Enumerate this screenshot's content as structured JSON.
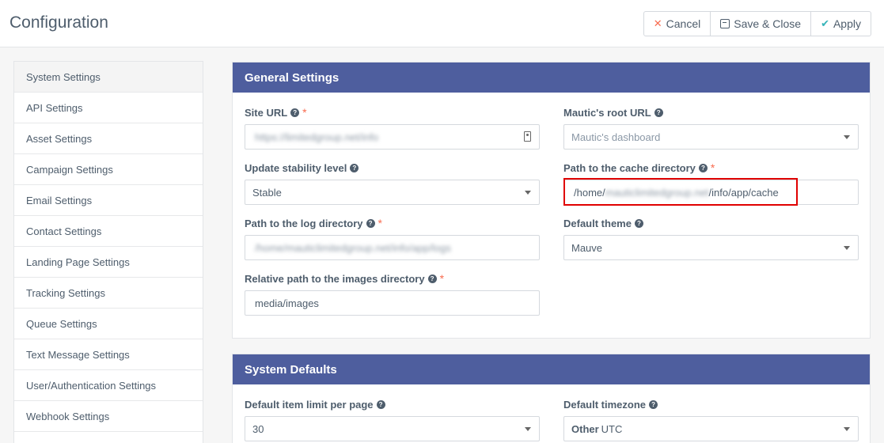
{
  "page": {
    "title": "Configuration"
  },
  "toolbar": {
    "cancel_label": "Cancel",
    "save_close_label": "Save & Close",
    "apply_label": "Apply"
  },
  "sidebar": {
    "items": [
      {
        "label": "System Settings"
      },
      {
        "label": "API Settings"
      },
      {
        "label": "Asset Settings"
      },
      {
        "label": "Campaign Settings"
      },
      {
        "label": "Email Settings"
      },
      {
        "label": "Contact Settings"
      },
      {
        "label": "Landing Page Settings"
      },
      {
        "label": "Tracking Settings"
      },
      {
        "label": "Queue Settings"
      },
      {
        "label": "Text Message Settings"
      },
      {
        "label": "User/Authentication Settings"
      },
      {
        "label": "Webhook Settings"
      }
    ]
  },
  "general": {
    "title": "General Settings",
    "site_url": {
      "label": "Site URL",
      "value": "https://limitedgroup.net/info"
    },
    "root_url": {
      "label": "Mautic's root URL",
      "placeholder": "Mautic's dashboard"
    },
    "stability": {
      "label": "Update stability level",
      "value": "Stable"
    },
    "cache_path": {
      "label": "Path to the cache directory",
      "prefix": "/home/",
      "masked": "mauticlimitedgroup.net",
      "suffix": "/info/app/cache"
    },
    "log_path": {
      "label": "Path to the log directory",
      "value": "/home/mauticlimitedgroup.net/info/app/logs"
    },
    "theme": {
      "label": "Default theme",
      "value": "Mauve"
    },
    "images_path": {
      "label": "Relative path to the images directory",
      "value": "media/images"
    }
  },
  "defaults": {
    "title": "System Defaults",
    "item_limit": {
      "label": "Default item limit per page",
      "value": "30"
    },
    "timezone": {
      "label": "Default timezone",
      "group": "Other",
      "value": "UTC"
    }
  }
}
